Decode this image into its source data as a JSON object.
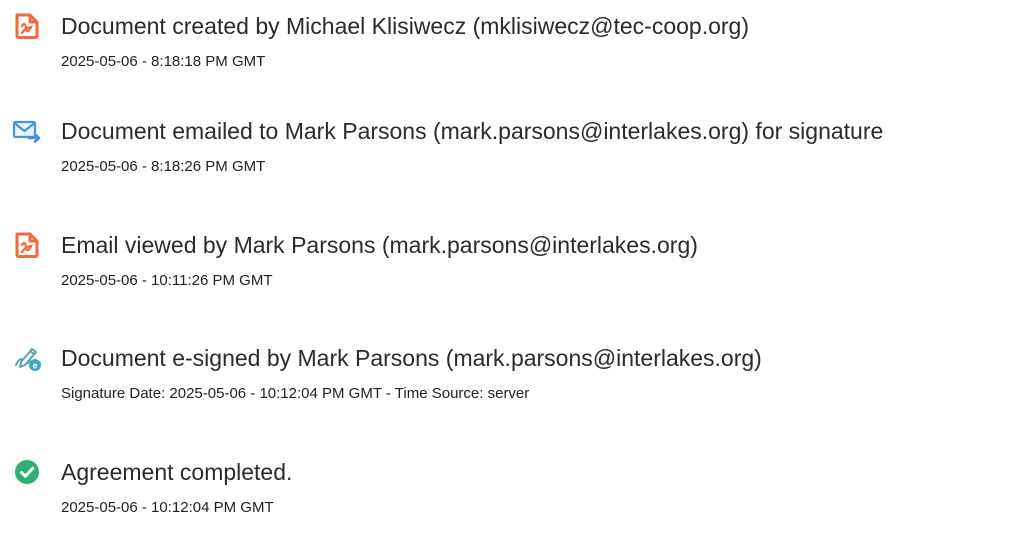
{
  "colors": {
    "doc_icon": "#f26a3d",
    "email_icon": "#4a90e2",
    "sign_icon": "#3fa9c5",
    "check_icon": "#2fae73",
    "text": "#2b2b2b"
  },
  "events": [
    {
      "icon": "document-icon",
      "title": "Document created by Michael Klisiwecz (mklisiwecz@tec-coop.org)",
      "detail": "2025-05-06 - 8:18:18 PM GMT"
    },
    {
      "icon": "email-icon",
      "title": "Document emailed to Mark Parsons (mark.parsons@interlakes.org) for signature",
      "detail": "2025-05-06 - 8:18:26 PM GMT"
    },
    {
      "icon": "document-icon",
      "title": "Email viewed by Mark Parsons (mark.parsons@interlakes.org)",
      "detail": "2025-05-06 - 10:11:26 PM GMT"
    },
    {
      "icon": "esign-icon",
      "title": "Document e-signed by Mark Parsons (mark.parsons@interlakes.org)",
      "detail": "Signature Date: 2025-05-06 - 10:12:04 PM GMT - Time Source: server"
    },
    {
      "icon": "check-circle-icon",
      "title": "Agreement completed.",
      "detail": "2025-05-06 - 10:12:04 PM GMT"
    }
  ]
}
